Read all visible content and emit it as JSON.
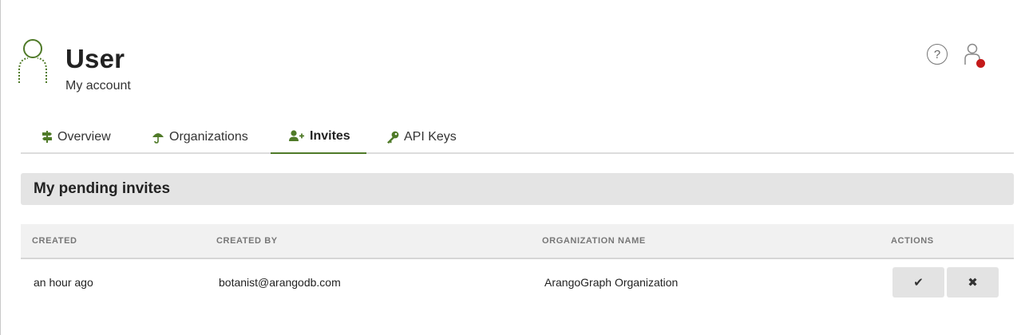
{
  "header": {
    "title": "User",
    "subtitle": "My account",
    "help_glyph": "?",
    "icons": {
      "avatar": "user-outline-icon",
      "help": "question-circle-icon",
      "account": "user-icon"
    },
    "accent_color": "#4f7a28",
    "notification_color": "#c41a1a"
  },
  "tabs": [
    {
      "label": "Overview",
      "icon": "signpost-icon",
      "active": false
    },
    {
      "label": "Organizations",
      "icon": "umbrella-icon",
      "active": false
    },
    {
      "label": "Invites",
      "icon": "user-plus-icon",
      "active": true
    },
    {
      "label": "API Keys",
      "icon": "key-icon",
      "active": false
    }
  ],
  "section": {
    "title": "My pending invites"
  },
  "table": {
    "columns": [
      "CREATED",
      "CREATED BY",
      "ORGANIZATION NAME",
      "ACTIONS"
    ],
    "rows": [
      {
        "created": "an hour ago",
        "created_by": "botanist@arangodb.com",
        "organization_name": "ArangoGraph Organization",
        "accept_glyph": "✔",
        "reject_glyph": "✖"
      }
    ]
  }
}
